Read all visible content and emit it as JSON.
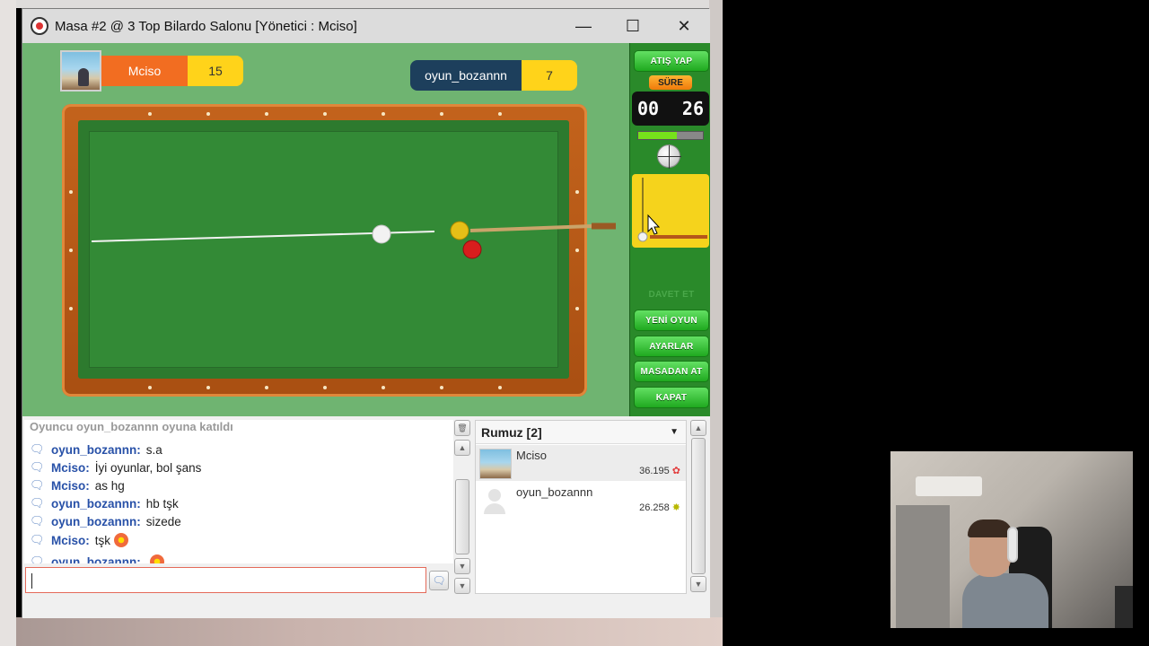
{
  "window": {
    "title": "Masa #2 @ 3 Top Bilardo Salonu [Yönetici : Mciso]",
    "minimize_glyph": "—",
    "maximize_glyph": "☐",
    "close_glyph": "✕"
  },
  "players": [
    {
      "name": "Mciso",
      "score": "15",
      "color": "#f26d21"
    },
    {
      "name": "oyun_bozannn",
      "score": "7",
      "color": "#1d3f5c"
    }
  ],
  "panel": {
    "shoot_label": "ATIŞ YAP",
    "time_label": "SÜRE",
    "timer_min": "00",
    "timer_sec": "26",
    "time_remaining_fraction": 0.6,
    "invite_label": "DAVET ET",
    "new_game_label": "YENİ OYUN",
    "settings_label": "AYARLAR",
    "kick_label": "MASADAN AT",
    "close_label": "KAPAT"
  },
  "chat": {
    "system_message": "Oyuncu oyun_bozannn oyuna katıldı",
    "messages": [
      {
        "user": "oyun_bozannn:",
        "text": "s.a"
      },
      {
        "user": "Mciso:",
        "text": "İyi oyunlar, bol şans"
      },
      {
        "user": "Mciso:",
        "text": "as hg"
      },
      {
        "user": "oyun_bozannn:",
        "text": "hb tşk"
      },
      {
        "user": "oyun_bozannn:",
        "text": "sizede"
      },
      {
        "user": "Mciso:",
        "text": "tşk",
        "emoji": "flower"
      },
      {
        "user": "oyun_bozannn:",
        "text": "",
        "emoji": "flower"
      }
    ],
    "input_value": "",
    "message_icon": "chat-bubble-icon"
  },
  "users": {
    "header": "Rumuz [2]",
    "list": [
      {
        "name": "Mciso",
        "points": "36.195",
        "badge": "✿",
        "badge_color": "#e23b3b"
      },
      {
        "name": "oyun_bozannn",
        "points": "26.258",
        "badge": "✸",
        "badge_color": "#b8b800"
      }
    ]
  },
  "colors": {
    "felt": "#338a36",
    "rail": "#b5561a",
    "panel_green": "#2a8a2a",
    "power_box": "#f5d31c"
  }
}
